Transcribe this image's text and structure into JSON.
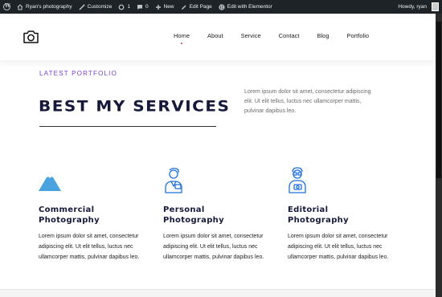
{
  "adminbar": {
    "site_name": "Ryan's photography",
    "customize": "Customize",
    "updates_count": "1",
    "comments_count": "0",
    "new_label": "New",
    "edit_page": "Edit Page",
    "edit_elementor": "Edit with Elementor",
    "greeting": "Howdy, ryan"
  },
  "nav": {
    "items": [
      {
        "label": "Home",
        "active": true
      },
      {
        "label": "About"
      },
      {
        "label": "Service"
      },
      {
        "label": "Contact"
      },
      {
        "label": "Blog"
      },
      {
        "label": "Portfolio"
      }
    ]
  },
  "section": {
    "eyebrow": "LATEST PORTFOLIO",
    "title": "BEST MY SERVICES",
    "intro": "Lorem ipsum dolor sit amet, consectetur adipiscing elit. Ut elit tellus, luctus nec ullamcorper mattis, pulvinar dapibus leo."
  },
  "cards": [
    {
      "icon": "mountain-icon",
      "title_line1": "Commercial",
      "title_line2": "Photography",
      "text": "Lorem ipsum dolor sit amet, consectetur adipiscing elit. Ut elit tellus, luctus nec ullamcorper mattis, pulvinar dapibus leo."
    },
    {
      "icon": "person-icon",
      "title_line1": "Personal",
      "title_line2": "Photography",
      "text": "Lorem ipsum dolor sit amet, consectetur adipiscing elit. Ut elit tellus, luctus nec ullamcorper mattis, pulvinar dapibus leo."
    },
    {
      "icon": "photographer-icon",
      "title_line1": "Editorial",
      "title_line2": "Photography",
      "text": "Lorem ipsum dolor sit amet, consectetur adipiscing elit. Ut elit tellus, luctus nec ullamcorper mattis, pulvinar dapibus leo."
    }
  ],
  "colors": {
    "adminbar_bg": "#1d2327",
    "eyebrow": "#7a3fd0",
    "heading": "#161a3a",
    "icon_blue": "#1e6fd9",
    "mountain_blue": "#4aa3df",
    "active_dot": "#e5396e"
  }
}
